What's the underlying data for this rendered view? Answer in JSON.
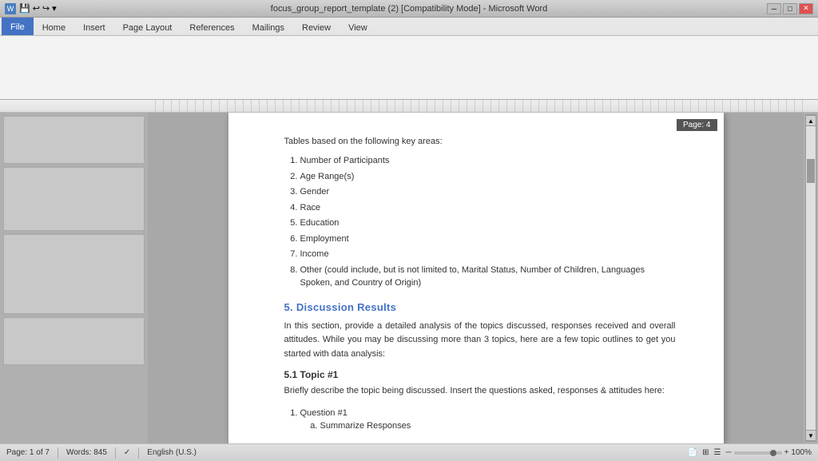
{
  "titlebar": {
    "title": "focus_group_report_template (2) [Compatibility Mode] - Microsoft Word",
    "controls": [
      "minimize",
      "restore",
      "close"
    ]
  },
  "ribbon": {
    "tabs": [
      "File",
      "Home",
      "Insert",
      "Page Layout",
      "References",
      "Mailings",
      "Review",
      "View"
    ],
    "active_tab": "File"
  },
  "page": {
    "page_number": "Page: 4",
    "intro_text": "Tables based on the following key areas:",
    "list_items": [
      "Number of Participants",
      "Age Range(s)",
      "Gender",
      "Race",
      "Education",
      "Employment",
      "Income",
      "Other (could include, but is not limited to, Marital Status, Number of Children, Languages Spoken, and Country of Origin)"
    ],
    "section5_heading": "5. Discussion Results",
    "section5_body": "In this section, provide a detailed analysis of the topics discussed, responses received and overall attitudes.  While you may be discussing more than 3 topics, here are a few topic outlines to get you started with data analysis:",
    "section51_heading": "5.1 Topic #1",
    "section51_body": "Briefly describe the topic being discussed.  Insert the questions asked, responses & attitudes here:",
    "nested_list": [
      {
        "item": "Question #1",
        "sub_items": [
          "Summarize Responses"
        ]
      }
    ]
  },
  "statusbar": {
    "pages": "Page: 1 of 7",
    "words": "Words: 845",
    "language": "English (U.S.)",
    "zoom": "100%"
  }
}
